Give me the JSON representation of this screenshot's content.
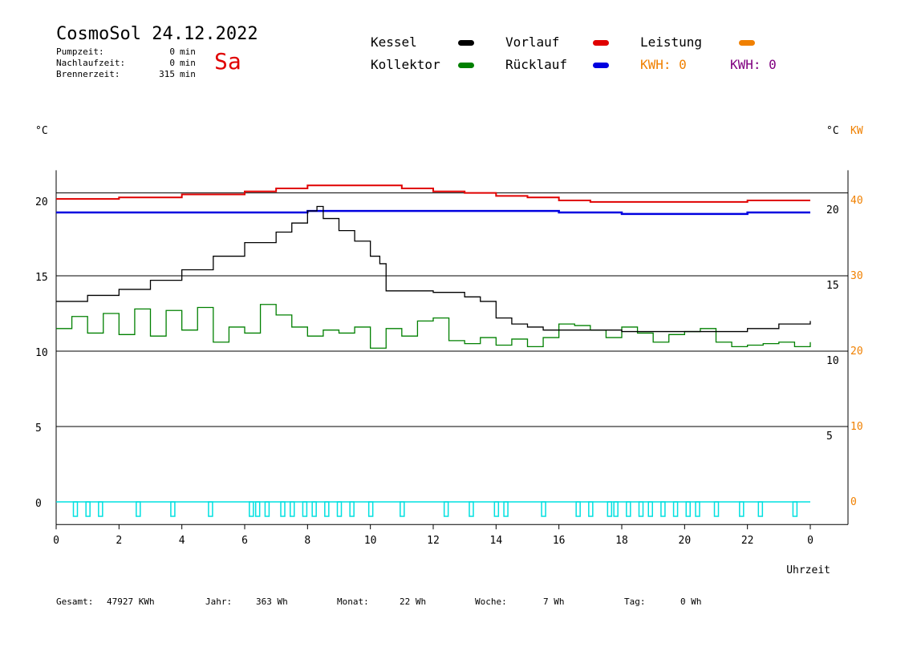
{
  "header": {
    "title": "CosmoSol 24.12.2022",
    "day": "Sa",
    "stats": [
      {
        "label": "Pumpzeit:",
        "value": "0",
        "unit": "min"
      },
      {
        "label": "Nachlaufzeit:",
        "value": "0",
        "unit": "min"
      },
      {
        "label": "Brennerzeit:",
        "value": "315",
        "unit": "min"
      }
    ]
  },
  "legend": {
    "kessel": "Kessel",
    "kollektor": "Kollektor",
    "vorlauf": "Vorlauf",
    "ruecklauf": "Rücklauf",
    "leistung": "Leistung",
    "kwh1": "KWH: 0",
    "kwh2": "KWH: 0"
  },
  "colors": {
    "kessel": "#000000",
    "kollektor": "#008000",
    "vorlauf": "#e00000",
    "ruecklauf": "#0000e0",
    "leistung": "#f08000",
    "kwh2": "#800080",
    "pump": "#00e0e0"
  },
  "axis_units": {
    "left": "°C",
    "right_c": "°C",
    "right_kw": "KW"
  },
  "footer": {
    "gesamt_label": "Gesamt:",
    "gesamt_value": "47927 KWh",
    "jahr_label": "Jahr:",
    "jahr_value": "363 Wh",
    "monat_label": "Monat:",
    "monat_value": "22 Wh",
    "woche_label": "Woche:",
    "woche_value": "7 Wh",
    "tag_label": "Tag:",
    "tag_value": "0 Wh"
  },
  "chart_data": {
    "type": "line",
    "xlabel": "Uhrzeit",
    "xlim": [
      0,
      24
    ],
    "ylim": [
      -1.5,
      22
    ],
    "x_ticks": [
      0,
      2,
      4,
      6,
      8,
      10,
      12,
      14,
      16,
      18,
      20,
      22,
      24
    ],
    "x_tick_labels": [
      "0",
      "2",
      "4",
      "6",
      "8",
      "10",
      "12",
      "14",
      "16",
      "18",
      "20",
      "22",
      "0"
    ],
    "y_ticks_left": [
      0,
      5,
      10,
      15,
      20
    ],
    "y_ticks_right_c": [
      5,
      10,
      15,
      20
    ],
    "y_ticks_right_kw": [
      0,
      10,
      20,
      30,
      40
    ],
    "grid_y": [
      5,
      10,
      15,
      20.5
    ],
    "series": [
      {
        "name": "Vorlauf",
        "key": "vorlauf",
        "x": [
          0,
          2,
          4,
          6,
          7,
          8,
          9,
          10,
          11,
          12,
          13,
          14,
          15,
          16,
          17,
          18,
          19,
          20,
          21,
          22,
          23,
          24
        ],
        "y": [
          20.1,
          20.2,
          20.4,
          20.6,
          20.8,
          21.0,
          21.0,
          21.0,
          20.8,
          20.6,
          20.5,
          20.3,
          20.2,
          20.0,
          19.9,
          19.9,
          19.9,
          19.9,
          19.9,
          20.0,
          20.0,
          20.0
        ]
      },
      {
        "name": "Rücklauf",
        "key": "ruecklauf",
        "x": [
          0,
          2,
          4,
          6,
          8,
          10,
          12,
          14,
          16,
          18,
          20,
          22,
          24
        ],
        "y": [
          19.2,
          19.2,
          19.2,
          19.2,
          19.3,
          19.3,
          19.3,
          19.3,
          19.2,
          19.1,
          19.1,
          19.2,
          19.2
        ]
      },
      {
        "name": "Kessel",
        "key": "kessel",
        "x": [
          0,
          1,
          2,
          3,
          4,
          5,
          6,
          7,
          7.5,
          8,
          8.3,
          8.5,
          9,
          9.5,
          10,
          10.3,
          10.5,
          11,
          12,
          13,
          13.5,
          14,
          14.5,
          15,
          15.5,
          16,
          17,
          18,
          19,
          20,
          21,
          22,
          23,
          24
        ],
        "y": [
          13.3,
          13.7,
          14.1,
          14.7,
          15.4,
          16.3,
          17.2,
          17.9,
          18.5,
          19.3,
          19.6,
          18.8,
          18.0,
          17.3,
          16.3,
          15.8,
          14.0,
          14.0,
          13.9,
          13.6,
          13.3,
          12.2,
          11.8,
          11.6,
          11.4,
          11.4,
          11.4,
          11.3,
          11.3,
          11.3,
          11.3,
          11.5,
          11.8,
          12.0
        ]
      },
      {
        "name": "Kollektor",
        "key": "kollektor",
        "x": [
          0,
          0.5,
          1,
          1.5,
          2,
          2.5,
          3,
          3.5,
          4,
          4.5,
          5,
          5.5,
          6,
          6.5,
          7,
          7.5,
          8,
          8.5,
          9,
          9.5,
          10,
          10.5,
          11,
          11.5,
          12,
          12.5,
          13,
          13.5,
          14,
          14.5,
          15,
          15.5,
          16,
          16.5,
          17,
          17.5,
          18,
          18.5,
          19,
          19.5,
          20,
          20.5,
          21,
          21.5,
          22,
          22.5,
          23,
          23.5,
          24
        ],
        "y": [
          11.5,
          12.3,
          11.2,
          12.5,
          11.1,
          12.8,
          11.0,
          12.7,
          11.4,
          12.9,
          10.6,
          11.6,
          11.2,
          13.1,
          12.4,
          11.6,
          11.0,
          11.4,
          11.2,
          11.6,
          10.2,
          11.5,
          11.0,
          12.0,
          12.2,
          10.7,
          10.5,
          10.9,
          10.4,
          10.8,
          10.3,
          10.9,
          11.8,
          11.7,
          11.4,
          10.9,
          11.6,
          11.2,
          10.6,
          11.1,
          11.3,
          11.5,
          10.6,
          10.3,
          10.4,
          10.5,
          10.6,
          10.3,
          10.6
        ]
      }
    ],
    "pump_pulses": [
      0.6,
      1.0,
      1.4,
      2.6,
      3.7,
      4.9,
      6.2,
      6.4,
      6.7,
      7.2,
      7.5,
      7.9,
      8.2,
      8.6,
      9.0,
      9.4,
      10.0,
      11.0,
      12.4,
      13.2,
      14.0,
      14.3,
      15.5,
      16.6,
      17.0,
      17.6,
      17.8,
      18.2,
      18.6,
      18.9,
      19.3,
      19.7,
      20.1,
      20.4,
      21.0,
      21.8,
      22.4,
      23.5
    ]
  }
}
